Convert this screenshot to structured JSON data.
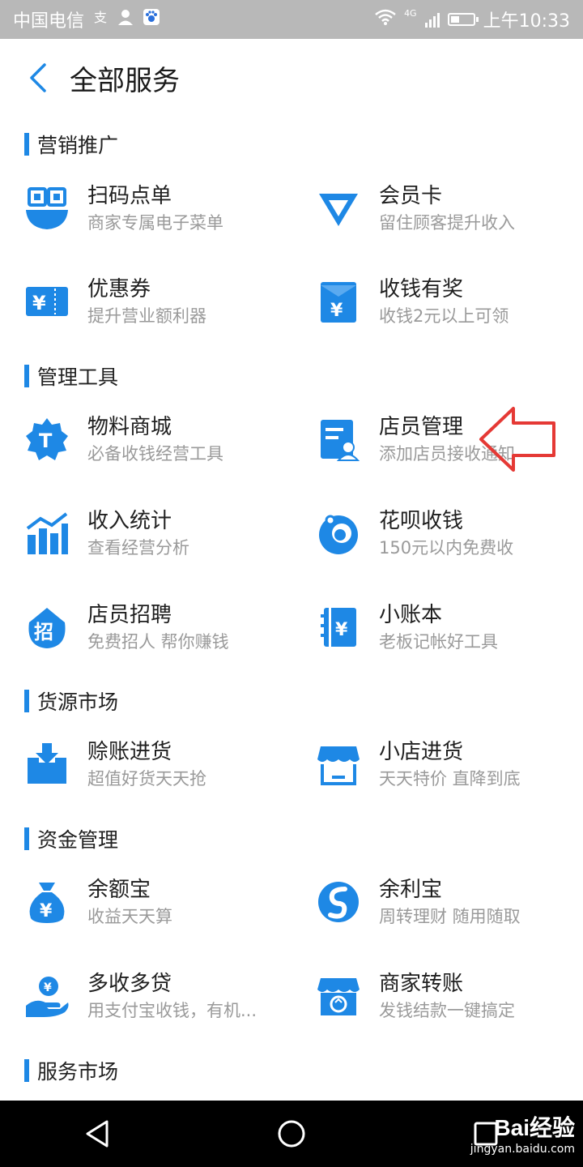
{
  "status_bar": {
    "carrier": "中国电信",
    "time": "上午10:33",
    "network": "4G"
  },
  "header": {
    "title": "全部服务"
  },
  "colors": {
    "accent": "#1e88e5",
    "annotation_arrow": "#e53935"
  },
  "sections": [
    {
      "title": "营销推广",
      "items": [
        {
          "title": "扫码点单",
          "subtitle": "商家专属电子菜单",
          "icon": "qr-bowl-icon"
        },
        {
          "title": "会员卡",
          "subtitle": "留住顾客提升收入",
          "icon": "diamond-icon"
        },
        {
          "title": "优惠券",
          "subtitle": "提升营业额利器",
          "icon": "coupon-icon"
        },
        {
          "title": "收钱有奖",
          "subtitle": "收钱2元以上可领",
          "icon": "red-envelope-icon"
        }
      ]
    },
    {
      "title": "管理工具",
      "items": [
        {
          "title": "物料商城",
          "subtitle": "必备收钱经营工具",
          "icon": "badge-t-icon"
        },
        {
          "title": "店员管理",
          "subtitle": "添加店员接收通知",
          "icon": "staff-doc-icon"
        },
        {
          "title": "收入统计",
          "subtitle": "查看经营分析",
          "icon": "bar-chart-icon"
        },
        {
          "title": "花呗收钱",
          "subtitle": "150元以内免费收",
          "icon": "huabei-icon"
        },
        {
          "title": "店员招聘",
          "subtitle": "免费招人 帮你赚钱",
          "icon": "recruit-icon"
        },
        {
          "title": "小账本",
          "subtitle": "老板记帐好工具",
          "icon": "ledger-icon"
        }
      ]
    },
    {
      "title": "货源市场",
      "items": [
        {
          "title": "赊账进货",
          "subtitle": "超值好货天天抢",
          "icon": "inbox-download-icon"
        },
        {
          "title": "小店进货",
          "subtitle": "天天特价 直降到底",
          "icon": "shop-icon"
        }
      ]
    },
    {
      "title": "资金管理",
      "items": [
        {
          "title": "余额宝",
          "subtitle": "收益天天算",
          "icon": "money-bag-icon"
        },
        {
          "title": "余利宝",
          "subtitle": "周转理财 随用随取",
          "icon": "yulibao-icon"
        },
        {
          "title": "多收多贷",
          "subtitle": "用支付宝收钱，有机...",
          "icon": "hand-coin-icon"
        },
        {
          "title": "商家转账",
          "subtitle": "发钱结款一键搞定",
          "icon": "store-transfer-icon"
        }
      ]
    },
    {
      "title": "服务市场",
      "items": []
    }
  ],
  "watermark": {
    "brand": "Bai经验",
    "url": "jingyan.baidu.com"
  }
}
